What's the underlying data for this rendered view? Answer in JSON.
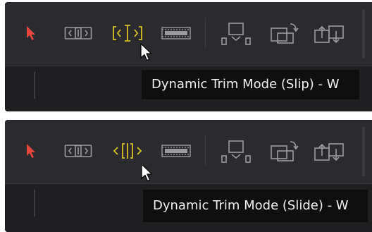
{
  "colors": {
    "panel_bg": "#2b2b2f",
    "track_bg": "#1f1f22",
    "pointer_red": "#e8463c",
    "active_yellow": "#d7c326",
    "inactive_icon": "#9a9aa0",
    "tooltip_bg": "#0f0f10",
    "tooltip_text": "#f0f0f0"
  },
  "panels": [
    {
      "active_tool": "slip",
      "tooltip": "Dynamic Trim Mode (Slip) - W",
      "icons": [
        "selection-pointer-icon",
        "trim-edit-icon",
        "dynamic-trim-slip-icon",
        "blade-icon",
        "insert-clip-icon",
        "overwrite-clip-icon",
        "replace-clip-icon"
      ]
    },
    {
      "active_tool": "slide",
      "tooltip": "Dynamic Trim Mode (Slide) - W",
      "icons": [
        "selection-pointer-icon",
        "trim-edit-icon",
        "dynamic-trim-slide-icon",
        "blade-icon",
        "insert-clip-icon",
        "overwrite-clip-icon",
        "replace-clip-icon"
      ]
    }
  ]
}
